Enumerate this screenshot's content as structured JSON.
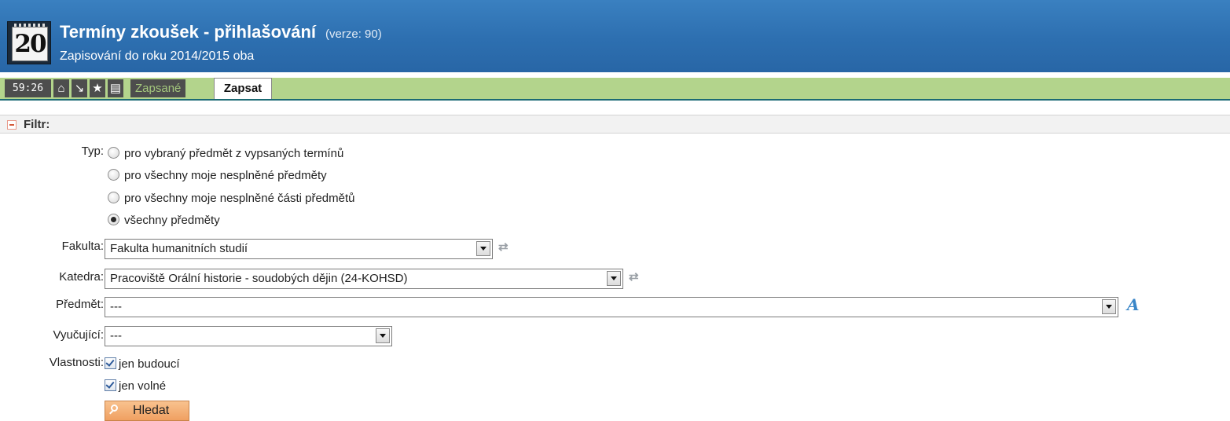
{
  "header": {
    "title": "Termíny zkoušek - přihlašování",
    "version": "(verze: 90)",
    "subtitle": "Zapisování do roku 2014/2015 oba",
    "logo_glyph": "20",
    "logo_icon": "calendar-icon"
  },
  "navbar": {
    "timer": "59:26",
    "icons": [
      "home-icon",
      "download-icon",
      "star-icon",
      "print-icon"
    ],
    "icon_glyphs": [
      "⌂",
      "↘",
      "★",
      "▤"
    ],
    "tabs": [
      {
        "label": "Zapsané",
        "active": false
      },
      {
        "label": "Zapsat",
        "active": true
      }
    ]
  },
  "filter": {
    "title": "Filtr:",
    "typ": {
      "label": "Typ:",
      "options": [
        {
          "label": "pro vybraný předmět z vypsaných termínů",
          "checked": false
        },
        {
          "label": "pro všechny moje nesplněné předměty",
          "checked": false
        },
        {
          "label": "pro všechny moje nesplněné části předmětů",
          "checked": false
        },
        {
          "label": "všechny předměty",
          "checked": true
        }
      ]
    },
    "fakulta": {
      "label": "Fakulta:",
      "value": "Fakulta humanitních studií"
    },
    "katedra": {
      "label": "Katedra:",
      "value": "Pracoviště Orální historie - soudobých dějin (24-KOHSD)"
    },
    "predmet": {
      "label": "Předmět:",
      "value": "---"
    },
    "vyucujici": {
      "label": "Vyučující:",
      "value": "---"
    },
    "vlastnosti": {
      "label": "Vlastnosti:",
      "options": [
        {
          "label": "jen budoucí",
          "checked": true
        },
        {
          "label": "jen volné",
          "checked": true
        }
      ]
    },
    "search_button": "Hledat"
  },
  "colors": {
    "header_blue": "#2d6fb0",
    "nav_green": "#b3d48c",
    "button_orange": "#f0a061"
  }
}
